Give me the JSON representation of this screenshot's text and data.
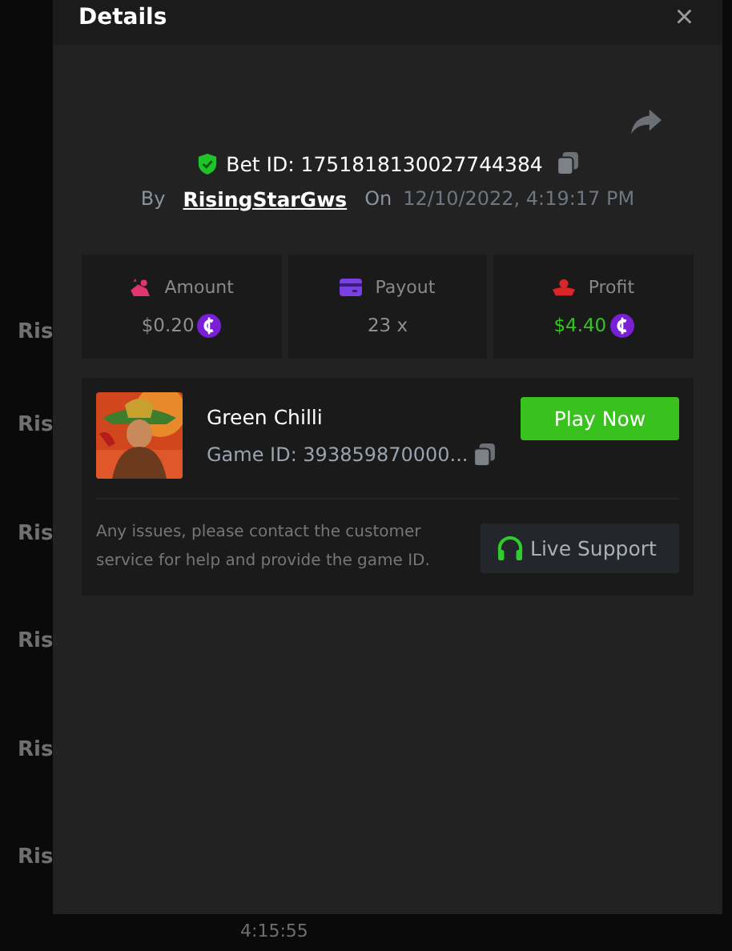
{
  "background": {
    "rows": [
      "Ris",
      "Ris",
      "Ris",
      "Ris",
      "Ris",
      "Ris"
    ],
    "bottom_time": "4:15:55"
  },
  "modal": {
    "title": "Details",
    "close": "×",
    "bet": {
      "verified": true,
      "label": "Bet ID: 1751818130027744384",
      "by_label": "By",
      "user": "RisingStarGws",
      "on_label": "On",
      "date": "12/10/2022, 4:19:17 PM"
    },
    "stats": [
      {
        "kind": "amount",
        "label": "Amount",
        "value": "$0.20",
        "coin": true,
        "color": "#e0356e",
        "positive": false
      },
      {
        "kind": "payout",
        "label": "Payout",
        "value": "23 x",
        "coin": false,
        "color": "#7b3fe4",
        "positive": false
      },
      {
        "kind": "profit",
        "label": "Profit",
        "value": "$4.40",
        "coin": true,
        "color": "#d8262b",
        "positive": true
      }
    ],
    "game": {
      "name": "Green Chilli",
      "id": "Game ID: 393859870000...",
      "play_button": "Play Now",
      "note": "Any issues, please contact the customer service for help and provide the game ID.",
      "support_button": "Live Support"
    }
  }
}
